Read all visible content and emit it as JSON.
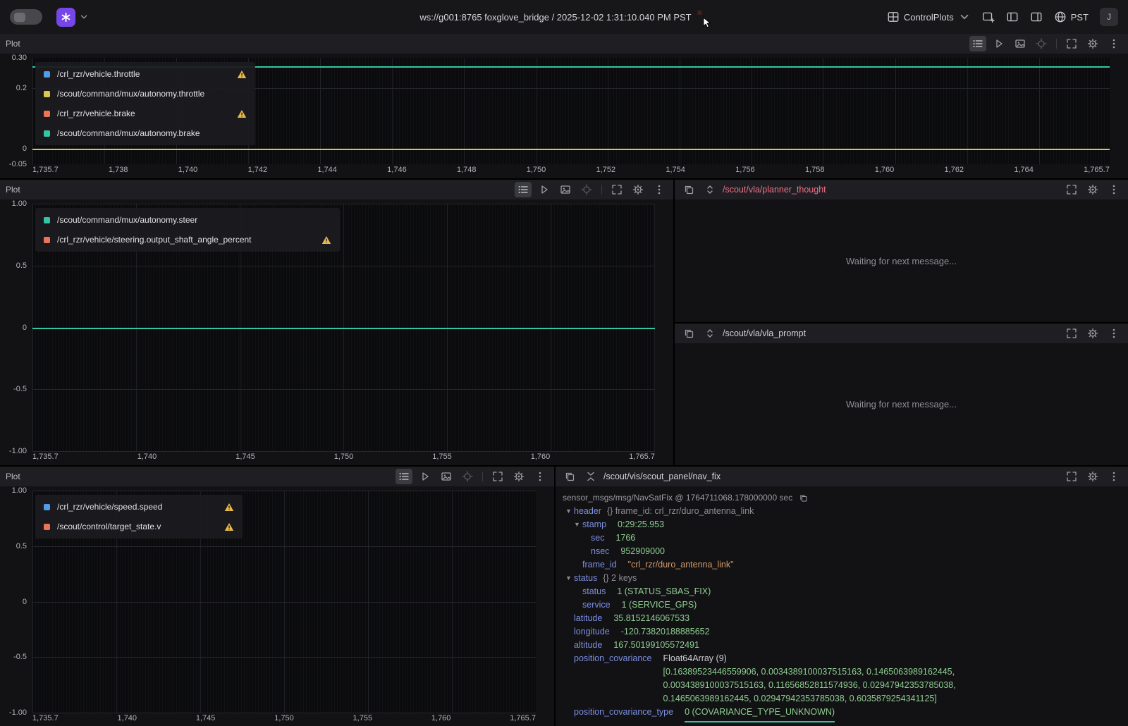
{
  "topbar": {
    "title": "ws://g001:8765 foxglove_bridge / 2025-12-02 1:31:10.040 PM PST",
    "layout_name": "ControlPlots",
    "timezone": "PST",
    "avatar_initial": "J"
  },
  "theme": {
    "accent_purple": "#7646e8",
    "record_red": "#e0413c",
    "topic_pink": "#ef7184",
    "key_blue": "#7d8fe0",
    "value_green": "#8fce91",
    "string_orange": "#d29a68",
    "panel_header_bg": "#1f1f23",
    "plot_bg": "#0b0b0d"
  },
  "icons": {
    "app-logo-icon": "asterisk-mark",
    "chevron-down-icon": "chevron-down",
    "record-dot": "red-circle",
    "mouse-cursor-icon": "pointer-arrow",
    "layout-grid-icon": "grid",
    "add-panel-icon": "rect-plus",
    "left-sidebar-icon": "panel-left",
    "right-sidebar-icon": "panel-right",
    "timezone-globe-icon": "globe",
    "legend-toggle-icon": "bulleted-list",
    "play-icon": "play-triangle",
    "export-image-icon": "image",
    "sync-crosshair-icon": "crosshair",
    "fullscreen-icon": "corner-brackets",
    "settings-icon": "gear",
    "more-icon": "vertical-ellipsis",
    "copy-icon": "overlapping-squares",
    "topic-stepper-icon": "chevrons-up-down",
    "collapse-all-icon": "chevrons-inward",
    "warning-icon": "triangle-exclamation",
    "expand-caret-icon": "triangle-down"
  },
  "panels": {
    "plot_top": {
      "title": "Plot"
    },
    "plot_mid": {
      "title": "Plot"
    },
    "plot_bottom": {
      "title": "Plot"
    },
    "planner_thought": {
      "topic": "/scout/vla/planner_thought",
      "topic_color": "#ef7184",
      "empty_text": "Waiting for next message..."
    },
    "vla_prompt": {
      "topic": "/scout/vla/vla_prompt",
      "empty_text": "Waiting for next message..."
    },
    "nav_fix": {
      "topic": "/scout/vis/scout_panel/nav_fix",
      "type_line": "sensor_msgs/msg/NavSatFix @ 1764711068.178000000 sec",
      "rows": [
        {
          "lclass": "l0",
          "caret": "▼",
          "key": "header",
          "meta": "{}  frame_id: crl_rzr/duro_antenna_link"
        },
        {
          "lclass": "l1",
          "caret": "▼",
          "key": "stamp",
          "value": "0:29:25.953",
          "vclass": "num"
        },
        {
          "lclass": "l2",
          "key": "sec",
          "value": "1766",
          "vclass": "num"
        },
        {
          "lclass": "l2",
          "key": "nsec",
          "value": "952909000",
          "vclass": "num"
        },
        {
          "lclass": "l1",
          "key": "frame_id",
          "value": "\"crl_rzr/duro_antenna_link\"",
          "vclass": "str"
        },
        {
          "lclass": "l0",
          "caret": "▼",
          "key": "status",
          "meta": "{}  2 keys"
        },
        {
          "lclass": "l1",
          "key": "status",
          "value": "1 (STATUS_SBAS_FIX)",
          "vclass": "num"
        },
        {
          "lclass": "l1",
          "key": "service",
          "value": "1 (SERVICE_GPS)",
          "vclass": "num"
        },
        {
          "lclass": "l0",
          "key": "latitude",
          "value": "35.8152146067533",
          "vclass": "num"
        },
        {
          "lclass": "l0",
          "key": "longitude",
          "value": "-120.73820188885652",
          "vclass": "num"
        },
        {
          "lclass": "l0",
          "key": "altitude",
          "value": "167.50199105572491",
          "vclass": "num"
        },
        {
          "lclass": "l0",
          "key": "position_covariance",
          "value": "Float64Array (9)",
          "vclass": "plain",
          "array_text": "[0.16389523446559906, 0.0034389100037515163, 0.1465063989162445,\n0.0034389100037515163, 0.11656852811574936, 0.02947942353785038,\n0.1465063989162445, 0.02947942353785038, 0.6035879254341125]"
        },
        {
          "lclass": "l0",
          "key": "position_covariance_type",
          "value": "0 (COVARIANCE_TYPE_UNKNOWN)",
          "vclass": "num underlined"
        }
      ]
    }
  },
  "chart_data": [
    {
      "type": "line",
      "panel": "plot_top",
      "xlim": [
        1735.7,
        1765.7
      ],
      "ylim": [
        -0.05,
        0.3
      ],
      "grid": true,
      "legend_position": "top-left-overlay",
      "x_ticks": [
        "1,735.7",
        "1,738",
        "1,740",
        "1,742",
        "1,744",
        "1,746",
        "1,748",
        "1,750",
        "1,752",
        "1,754",
        "1,756",
        "1,758",
        "1,760",
        "1,762",
        "1,764",
        "1,765.7"
      ],
      "y_ticks": [
        "0.30",
        "0.2",
        "0",
        "-0.05"
      ],
      "series": [
        {
          "name": "/crl_rzr/vehicle.throttle",
          "color": "#4f9ce8",
          "warning": true,
          "constant_value": null
        },
        {
          "name": "/scout/command/mux/autonomy.throttle",
          "color": "#dec64a",
          "warning": false,
          "constant_value": 0
        },
        {
          "name": "/crl_rzr/vehicle.brake",
          "color": "#ec7357",
          "warning": true,
          "constant_value": null
        },
        {
          "name": "/scout/command/mux/autonomy.brake",
          "color": "#33c6a6",
          "warning": false,
          "constant_value": 0.27
        }
      ]
    },
    {
      "type": "line",
      "panel": "plot_mid",
      "xlim": [
        1735.7,
        1765.7
      ],
      "ylim": [
        -1.0,
        1.0
      ],
      "grid": true,
      "legend_position": "top-left-overlay",
      "x_ticks": [
        "1,735.7",
        "1,740",
        "1,745",
        "1,750",
        "1,755",
        "1,760",
        "1,765.7"
      ],
      "y_ticks": [
        "1.00",
        "0.5",
        "0",
        "-0.5",
        "-1.00"
      ],
      "series": [
        {
          "name": "/scout/command/mux/autonomy.steer",
          "color": "#33c6a6",
          "warning": false,
          "constant_value": 0
        },
        {
          "name": "/crl_rzr/vehicle/steering.output_shaft_angle_percent",
          "color": "#ec7357",
          "warning": true,
          "constant_value": null
        }
      ]
    },
    {
      "type": "line",
      "panel": "plot_bottom",
      "xlim": [
        1735.7,
        1765.7
      ],
      "ylim": [
        -1.0,
        1.0
      ],
      "grid": true,
      "legend_position": "top-left-overlay",
      "x_ticks": [
        "1,735.7",
        "1,740",
        "1,745",
        "1,750",
        "1,755",
        "1,760",
        "1,765.7"
      ],
      "y_ticks": [
        "1.00",
        "0.5",
        "0",
        "-0.5",
        "-1.00"
      ],
      "series": [
        {
          "name": "/crl_rzr/vehicle/speed.speed",
          "color": "#4f9ce8",
          "warning": true,
          "constant_value": null
        },
        {
          "name": "/scout/control/target_state.v",
          "color": "#ec7357",
          "warning": true,
          "constant_value": null
        }
      ]
    }
  ]
}
